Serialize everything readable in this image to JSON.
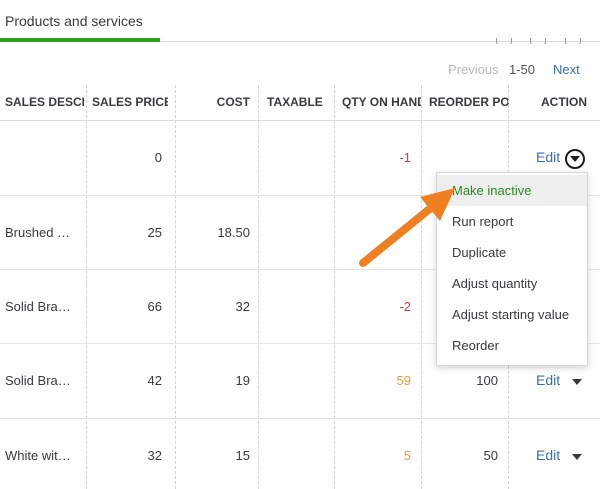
{
  "tab": {
    "label": "Products and services"
  },
  "pagination": {
    "previous": "Previous",
    "range": "1-50",
    "next": "Next"
  },
  "columns": [
    "SALES DESCRIPTION",
    "SALES PRICE",
    "COST",
    "TAXABLE",
    "QTY ON HAND",
    "REORDER POINT",
    "ACTION"
  ],
  "rows": [
    {
      "description": "",
      "sales_price": "0",
      "cost": "",
      "taxable": "",
      "qty_on_hand": "-1",
      "reorder_point": "",
      "action": "Edit"
    },
    {
      "description": "Brushed …",
      "sales_price": "25",
      "cost": "18.50",
      "taxable": "",
      "qty_on_hand": "",
      "reorder_point": "",
      "action": ""
    },
    {
      "description": "Solid Bra…",
      "sales_price": "66",
      "cost": "32",
      "taxable": "",
      "qty_on_hand": "-2",
      "reorder_point": "",
      "action": ""
    },
    {
      "description": "Solid Bra…",
      "sales_price": "42",
      "cost": "19",
      "taxable": "",
      "qty_on_hand": "59",
      "reorder_point": "100",
      "action": "Edit"
    },
    {
      "description": "White wit…",
      "sales_price": "32",
      "cost": "15",
      "taxable": "",
      "qty_on_hand": "5",
      "reorder_point": "50",
      "action": "Edit"
    }
  ],
  "action_menu": {
    "items": [
      "Make inactive",
      "Run report",
      "Duplicate",
      "Adjust quantity",
      "Adjust starting value",
      "Reorder"
    ],
    "highlighted": "Make inactive"
  },
  "colors": {
    "accent_green": "#2ca01c",
    "link_blue": "#3a6fae",
    "negative_red": "#c54444",
    "low_stock_orange": "#e8a03a",
    "annotation_arrow": "#f07f22"
  }
}
